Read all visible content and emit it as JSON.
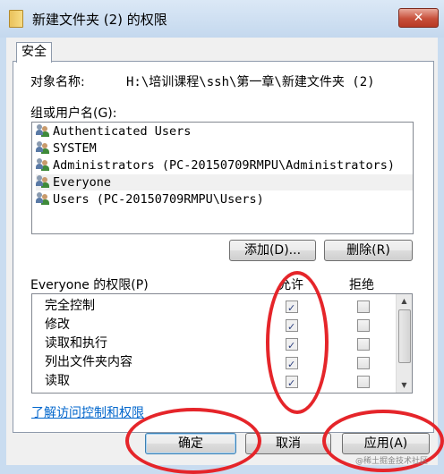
{
  "window": {
    "title": "新建文件夹 (2) 的权限",
    "close_label": "✕"
  },
  "tab": {
    "label": "安全"
  },
  "object": {
    "label": "对象名称:",
    "value": "H:\\培训课程\\ssh\\第一章\\新建文件夹 (2)"
  },
  "group": {
    "label": "组或用户名(G):"
  },
  "users": [
    {
      "name": "Authenticated Users",
      "selected": false
    },
    {
      "name": "SYSTEM",
      "selected": false
    },
    {
      "name": "Administrators (PC-20150709RMPU\\Administrators)",
      "selected": false
    },
    {
      "name": "Everyone",
      "selected": true
    },
    {
      "name": "Users (PC-20150709RMPU\\Users)",
      "selected": false
    }
  ],
  "buttons": {
    "add": "添加(D)...",
    "remove": "删除(R)",
    "ok": "确定",
    "cancel": "取消",
    "apply": "应用(A)"
  },
  "permissions": {
    "label": "Everyone 的权限(P)",
    "allow_header": "允许",
    "deny_header": "拒绝",
    "rows": [
      {
        "name": "完全控制",
        "allow": true,
        "deny": false
      },
      {
        "name": "修改",
        "allow": true,
        "deny": false
      },
      {
        "name": "读取和执行",
        "allow": true,
        "deny": false
      },
      {
        "name": "列出文件夹内容",
        "allow": true,
        "deny": false
      },
      {
        "name": "读取",
        "allow": true,
        "deny": false
      }
    ]
  },
  "link": {
    "learn_more": "了解访问控制和权限"
  },
  "watermark": "@稀土掘金技术社区",
  "colors": {
    "annotation": "#e5252a",
    "link": "#0066cc",
    "close": "#c74f3a"
  }
}
